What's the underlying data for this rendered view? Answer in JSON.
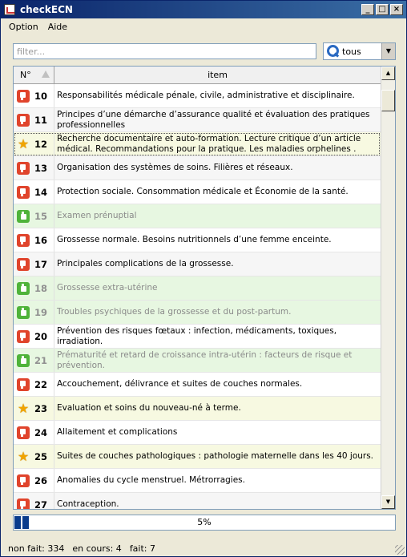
{
  "window": {
    "title": "checkECN"
  },
  "menu": [
    {
      "label": "Option"
    },
    {
      "label": "Aide"
    }
  ],
  "filter": {
    "placeholder": "filter...",
    "value": ""
  },
  "scope_select": {
    "value": "tous",
    "icon": "search-icon"
  },
  "table": {
    "columns": {
      "num": "N°",
      "item": "item"
    },
    "rows": [
      {
        "status": "todo",
        "num": "10",
        "text": "Responsabilités médicale pénale, civile, administrative et disciplinaire."
      },
      {
        "status": "todo",
        "num": "11",
        "text": "Principes d’une démarche d’assurance qualité et évaluation des pratiques professionnelles"
      },
      {
        "status": "star",
        "num": "12",
        "text": "Recherche documentaire et auto-formation. Lecture critique d’un article médical. Recommandations pour la pratique. Les maladies orphelines .",
        "selected": true
      },
      {
        "status": "todo",
        "num": "13",
        "text": "Organisation des systèmes de soins. Filières et réseaux."
      },
      {
        "status": "todo",
        "num": "14",
        "text": "Protection sociale. Consommation médicale et Économie de la santé."
      },
      {
        "status": "done",
        "num": "15",
        "text": "Examen prénuptial"
      },
      {
        "status": "todo",
        "num": "16",
        "text": "Grossesse normale. Besoins nutritionnels d’une femme enceinte."
      },
      {
        "status": "todo",
        "num": "17",
        "text": "Principales complications de la grossesse."
      },
      {
        "status": "done",
        "num": "18",
        "text": "Grossesse extra-utérine"
      },
      {
        "status": "done",
        "num": "19",
        "text": "Troubles psychiques de la grossesse et du post-partum."
      },
      {
        "status": "todo",
        "num": "20",
        "text": "Prévention des risques fœtaux : infection, médicaments, toxiques, irradiation."
      },
      {
        "status": "done",
        "num": "21",
        "text": "Prématurité et retard de croissance intra-utérin : facteurs de risque et prévention."
      },
      {
        "status": "todo",
        "num": "22",
        "text": "Accouchement, délivrance et suites de couches normales."
      },
      {
        "status": "star",
        "num": "23",
        "text": "Evaluation et soins du nouveau-né à terme."
      },
      {
        "status": "todo",
        "num": "24",
        "text": "Allaitement et complications"
      },
      {
        "status": "star",
        "num": "25",
        "text": "Suites de couches pathologiques : pathologie maternelle dans les 40 jours."
      },
      {
        "status": "todo",
        "num": "26",
        "text": "Anomalies du cycle menstruel. Métrorragies."
      },
      {
        "status": "todo",
        "num": "27",
        "text": "Contraception."
      }
    ]
  },
  "progress": {
    "label": "5%",
    "value": 0.05
  },
  "status": {
    "not_done": "non fait: 334",
    "in_progress": "en cours: 4",
    "done": "fait: 7"
  }
}
